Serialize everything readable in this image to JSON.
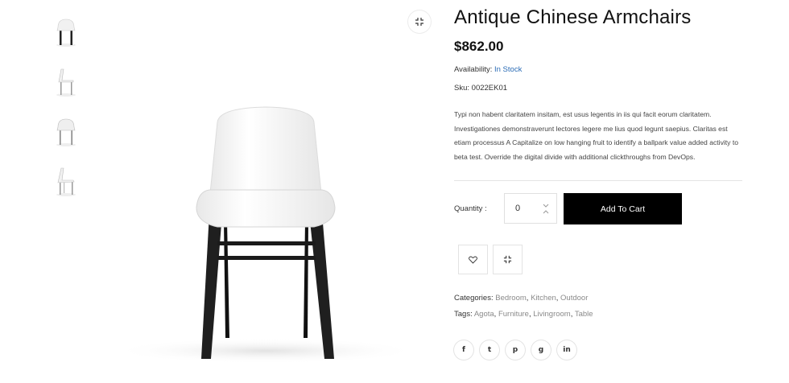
{
  "product": {
    "title": "Antique Chinese Armchairs",
    "price": "$862.00",
    "availability_label": "Availability:",
    "availability_value": "In Stock",
    "sku_label": "Sku:",
    "sku_value": "0022EK01",
    "description": "Typi non habent claritatem insitam, est usus legentis in iis qui facit eorum claritatem. Investigationes demonstraverunt lectores legere me lius quod legunt saepius. Claritas est etiam processus A Capitalize on low hanging fruit to identify a ballpark value added activity to beta test. Override the digital divide with additional clickthroughs from DevOps."
  },
  "purchase": {
    "quantity_label": "Quantity :",
    "quantity_value": "0",
    "add_to_cart_label": "Add To Cart"
  },
  "categories": {
    "label": "Categories:",
    "items": [
      "Bedroom",
      "Kitchen",
      "Outdoor"
    ]
  },
  "tags": {
    "label": "Tags:",
    "items": [
      "Agota",
      "Furniture",
      "Livingroom",
      "Table"
    ]
  },
  "social": [
    "f",
    "t",
    "p",
    "g",
    "in"
  ],
  "icons": {
    "zoom": "expand-icon",
    "wishlist": "heart-icon",
    "compare": "compare-icon",
    "social": [
      "facebook-icon",
      "twitter-icon",
      "pinterest-icon",
      "google-plus-icon",
      "linkedin-icon"
    ]
  },
  "colors": {
    "accent": "#2a6bb5",
    "cart_button": "#000000",
    "chair_seat": "#f4f4f4",
    "chair_legs": "#1f1f1f"
  }
}
